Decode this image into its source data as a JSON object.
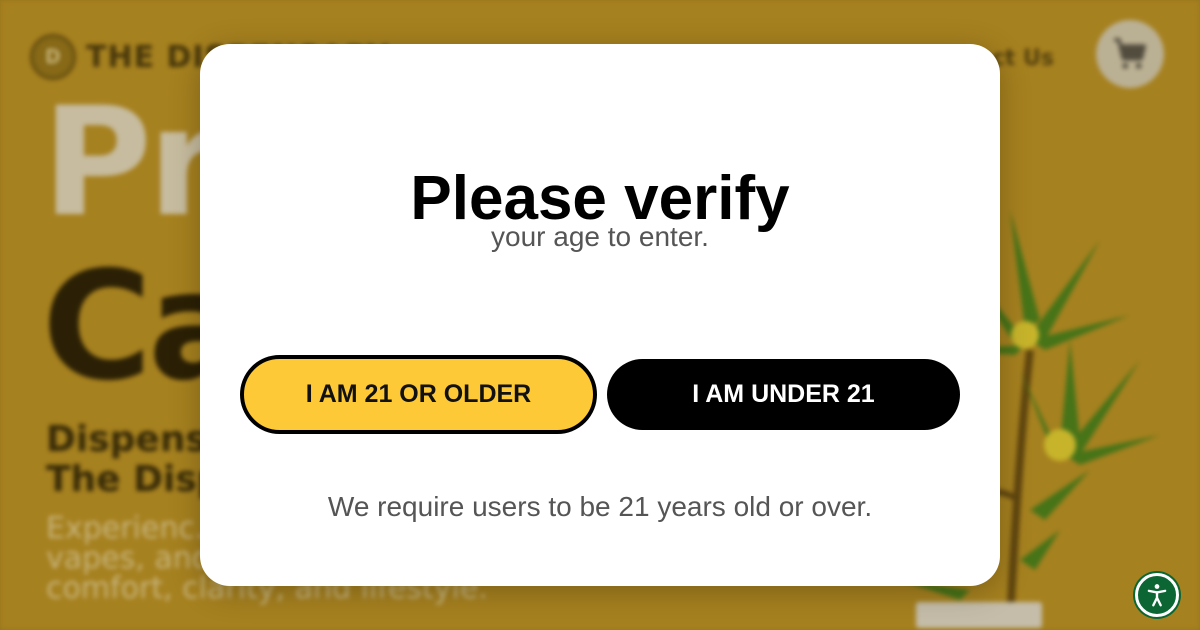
{
  "background": {
    "logo_mark": "D",
    "logo_text": "THE DISPENSARY",
    "nav_link": "Contact Us",
    "hero_line1": "Pr",
    "hero_line2": "Ca",
    "sub_line1": "Dispens",
    "sub_line2": "The Disp",
    "paragraph": "Experienc... Saddle Bro... of flowers, vapes, and edibles is designed for comfort, clarity, and lifestyle."
  },
  "modal": {
    "title": "Please verify",
    "subtitle": "your age to enter.",
    "older_label": "I AM 21 OR OLDER",
    "under_label": "I AM UNDER 21",
    "note": "We require users to be 21 years old or over."
  },
  "icons": {
    "cart": "cart-icon",
    "accessibility": "accessibility-icon"
  },
  "colors": {
    "accent_yellow": "#fdc936",
    "black": "#000000",
    "accessibility_green": "#0b6633",
    "overlay_tint": "#9a7a20"
  }
}
